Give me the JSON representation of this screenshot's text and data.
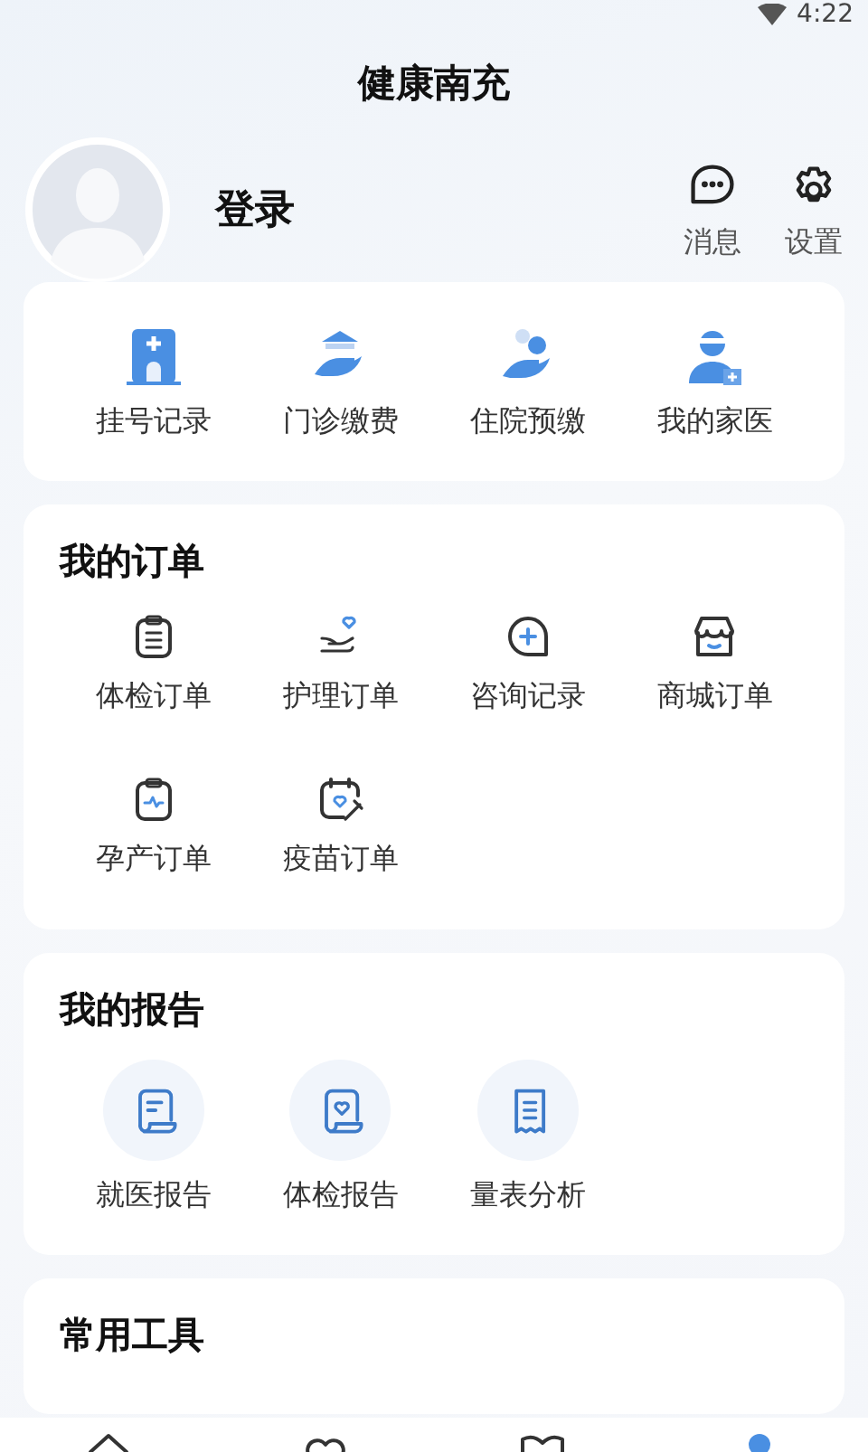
{
  "status_bar": {
    "time": "4:22"
  },
  "title": "健康南充",
  "profile": {
    "login": "登录",
    "actions": [
      {
        "kind": "message",
        "label": "消息"
      },
      {
        "kind": "settings",
        "label": "设置"
      }
    ]
  },
  "quick_services": [
    {
      "kind": "hospital",
      "label": "挂号记录"
    },
    {
      "kind": "pay",
      "label": "门诊缴费"
    },
    {
      "kind": "prepay",
      "label": "住院预缴"
    },
    {
      "kind": "doctor",
      "label": "我的家医"
    }
  ],
  "orders": {
    "title": "我的订单",
    "items": [
      {
        "kind": "clipboard",
        "label": "体检订单"
      },
      {
        "kind": "care",
        "label": "护理订单"
      },
      {
        "kind": "consult",
        "label": "咨询记录"
      },
      {
        "kind": "shop",
        "label": "商城订单"
      },
      {
        "kind": "pulse",
        "label": "孕产订单"
      },
      {
        "kind": "vaccine",
        "label": "疫苗订单"
      }
    ]
  },
  "reports": {
    "title": "我的报告",
    "items": [
      {
        "kind": "scroll",
        "label": "就医报告"
      },
      {
        "kind": "heart-scroll",
        "label": "体检报告"
      },
      {
        "kind": "receipt",
        "label": "量表分析"
      }
    ]
  },
  "tools": {
    "title": "常用工具"
  },
  "bottom_nav": [
    {
      "kind": "home",
      "selected": false
    },
    {
      "kind": "heart",
      "selected": false
    },
    {
      "kind": "book",
      "selected": false
    },
    {
      "kind": "person",
      "selected": true
    }
  ]
}
